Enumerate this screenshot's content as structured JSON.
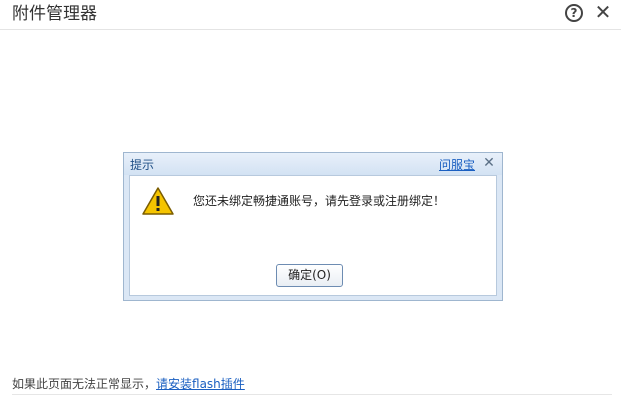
{
  "window": {
    "title": "附件管理器",
    "help_glyph": "?",
    "close_glyph": "✕"
  },
  "dialog": {
    "title": "提示",
    "brand_link": "问服宝",
    "close_glyph": "✕",
    "message": "您还未绑定畅捷通账号，请先登录或注册绑定！",
    "ok_label": "确定(O)"
  },
  "footer": {
    "text": "如果此页面无法正常显示，",
    "link": "请安装flash插件"
  },
  "icons": {
    "help": "help-circle-icon",
    "close": "close-icon",
    "warning": "warning-icon"
  },
  "colors": {
    "dialog_frame": "#dbe7f5",
    "link": "#1a5fc1",
    "warning_fill": "#f5c400"
  }
}
